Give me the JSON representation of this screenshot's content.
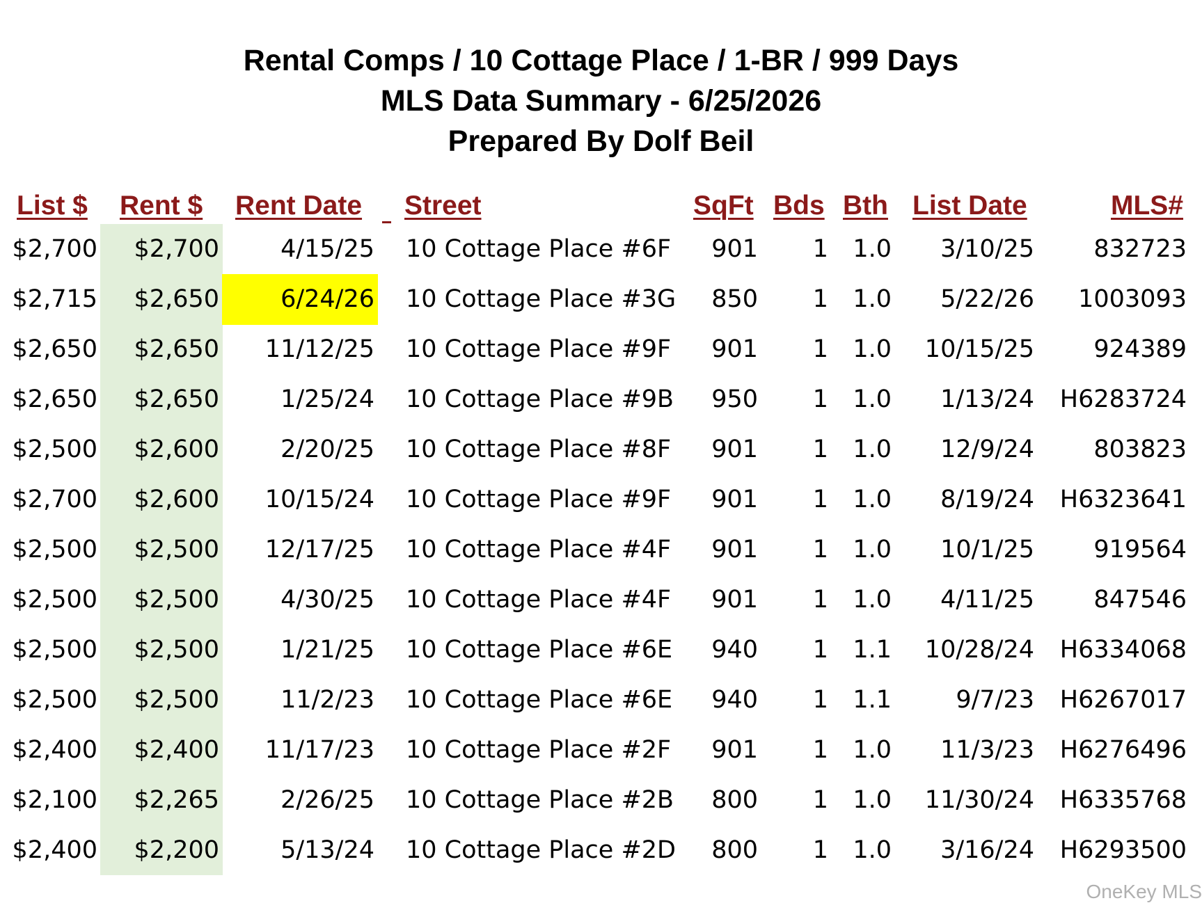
{
  "title": {
    "line1": "Rental Comps / 10 Cottage Place / 1-BR / 999 Days",
    "line2": "MLS Data Summary - 6/25/2026",
    "line3": "Prepared By Dolf Beil"
  },
  "columns": {
    "list_price": "List $",
    "rent_price": "Rent $",
    "rent_date": "Rent Date",
    "street": "Street",
    "sqft": "SqFt",
    "beds": "Bds",
    "baths": "Bth",
    "list_date": "List Date",
    "mls": "MLS#"
  },
  "colors": {
    "header_text": "#8b1a1a",
    "rent_column_fill": "#e2efda",
    "highlight_fill": "#ffff00",
    "watermark_text": "#b0b0b0"
  },
  "highlighted_cell": {
    "row": 2,
    "column": "rent_date"
  },
  "rows": [
    [
      "$2,700",
      "$2,700",
      "4/15/25",
      "10 Cottage Place #6F",
      "901",
      "1",
      "1.0",
      "3/10/25",
      "832723"
    ],
    [
      "$2,715",
      "$2,650",
      "6/24/26",
      "10 Cottage Place #3G",
      "850",
      "1",
      "1.0",
      "5/22/26",
      "1003093"
    ],
    [
      "$2,650",
      "$2,650",
      "11/12/25",
      "10 Cottage Place #9F",
      "901",
      "1",
      "1.0",
      "10/15/25",
      "924389"
    ],
    [
      "$2,650",
      "$2,650",
      "1/25/24",
      "10 Cottage Place #9B",
      "950",
      "1",
      "1.0",
      "1/13/24",
      "H6283724"
    ],
    [
      "$2,500",
      "$2,600",
      "2/20/25",
      "10 Cottage Place #8F",
      "901",
      "1",
      "1.0",
      "12/9/24",
      "803823"
    ],
    [
      "$2,700",
      "$2,600",
      "10/15/24",
      "10 Cottage Place #9F",
      "901",
      "1",
      "1.0",
      "8/19/24",
      "H6323641"
    ],
    [
      "$2,500",
      "$2,500",
      "12/17/25",
      "10 Cottage Place #4F",
      "901",
      "1",
      "1.0",
      "10/1/25",
      "919564"
    ],
    [
      "$2,500",
      "$2,500",
      "4/30/25",
      "10 Cottage Place #4F",
      "901",
      "1",
      "1.0",
      "4/11/25",
      "847546"
    ],
    [
      "$2,500",
      "$2,500",
      "1/21/25",
      "10 Cottage Place #6E",
      "940",
      "1",
      "1.1",
      "10/28/24",
      "H6334068"
    ],
    [
      "$2,500",
      "$2,500",
      "11/2/23",
      "10 Cottage Place #6E",
      "940",
      "1",
      "1.1",
      "9/7/23",
      "H6267017"
    ],
    [
      "$2,400",
      "$2,400",
      "11/17/23",
      "10 Cottage Place #2F",
      "901",
      "1",
      "1.0",
      "11/3/23",
      "H6276496"
    ],
    [
      "$2,100",
      "$2,265",
      "2/26/25",
      "10 Cottage Place #2B",
      "800",
      "1",
      "1.0",
      "11/30/24",
      "H6335768"
    ],
    [
      "$2,400",
      "$2,200",
      "5/13/24",
      "10 Cottage Place #2D",
      "800",
      "1",
      "1.0",
      "3/16/24",
      "H6293500"
    ]
  ],
  "watermark": "OneKey MLS"
}
